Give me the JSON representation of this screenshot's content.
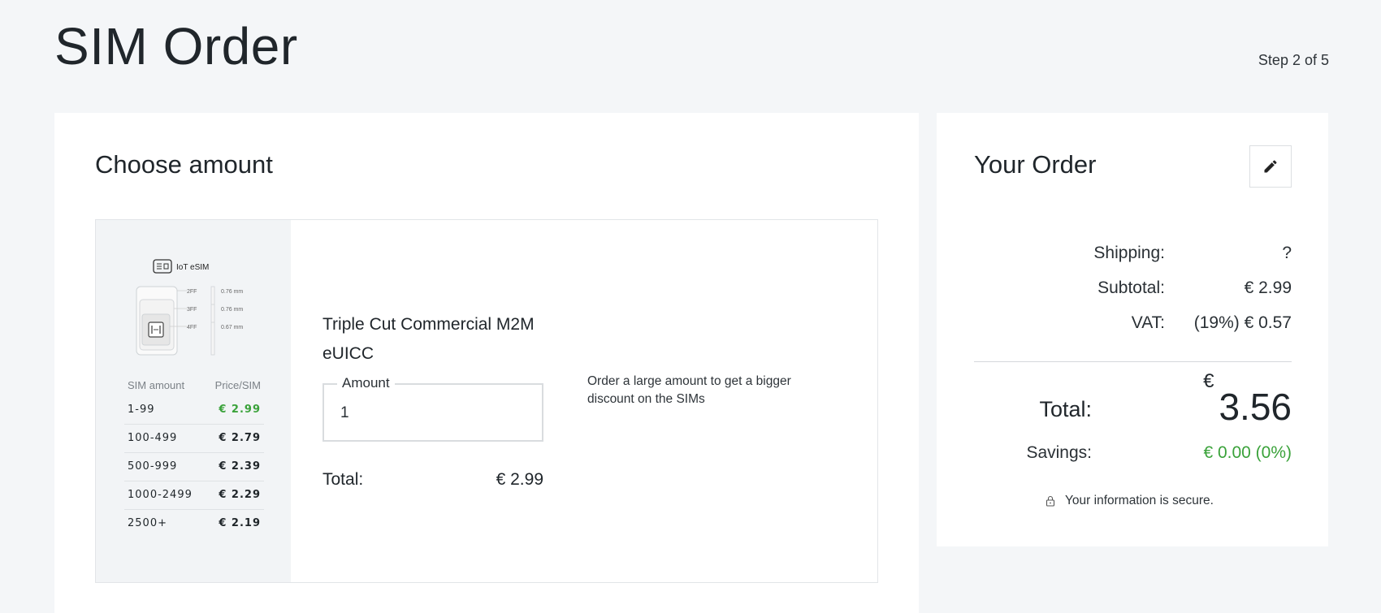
{
  "header": {
    "title": "SIM Order",
    "step": "Step 2 of 5"
  },
  "choose": {
    "title": "Choose amount",
    "image_brand": "IoT eSIM",
    "sim_formats": [
      "2FF",
      "3FF",
      "4FF"
    ],
    "sim_dims": [
      "0.76 mm",
      "0.76 mm",
      "0.67 mm"
    ],
    "price_table": {
      "headers": [
        "SIM amount",
        "Price/SIM"
      ],
      "rows": [
        {
          "amount": "1-99",
          "price": "€ 2.99",
          "active": true
        },
        {
          "amount": "100-499",
          "price": "€ 2.79",
          "active": false
        },
        {
          "amount": "500-999",
          "price": "€ 2.39",
          "active": false
        },
        {
          "amount": "1000-2499",
          "price": "€ 2.29",
          "active": false
        },
        {
          "amount": "2500+",
          "price": "€ 2.19",
          "active": false
        }
      ]
    },
    "product_name": "Triple Cut Commercial M2M eUICC",
    "amount_label": "Amount",
    "amount_value": "1",
    "total_label": "Total:",
    "total_value": "€ 2.99",
    "hint": "Order a large amount to get a bigger discount on the SIMs"
  },
  "order": {
    "title": "Your Order",
    "edit_icon": "pencil-icon",
    "shipping_label": "Shipping:",
    "shipping_value": "?",
    "subtotal_label": "Subtotal:",
    "subtotal_value": "€ 2.99",
    "vat_label": "VAT:",
    "vat_value": "(19%) € 0.57",
    "total_label": "Total:",
    "total_currency": "€",
    "total_value": "3.56",
    "savings_label": "Savings:",
    "savings_value": "€ 0.00 (0%)",
    "secure_text": "Your information is secure.",
    "secure_icon": "lock-icon"
  },
  "colors": {
    "accent_green": "#3aa23a",
    "background": "#f4f6f8"
  }
}
